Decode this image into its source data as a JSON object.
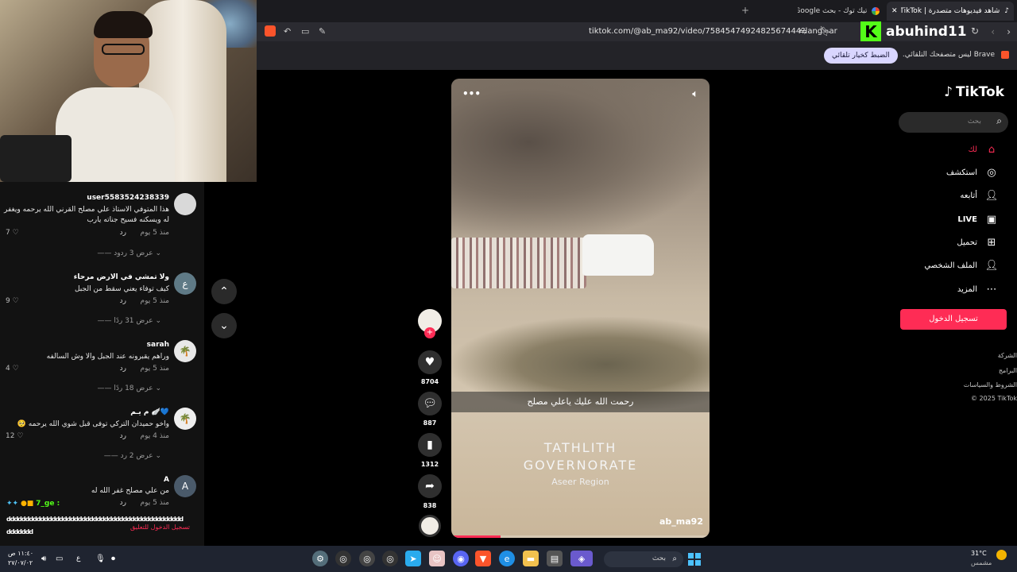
{
  "browser": {
    "tabs": [
      {
        "label": "شاهد فيديوهات متصدرة | TikTok",
        "active": true
      },
      {
        "label": "تيك توك - بحث Google",
        "active": false
      }
    ],
    "new_tab": "+",
    "url": "tiktok.com/@ab_ma92/video/7584547492482567444?lang=ar",
    "infobar_text": "Brave ليس متصفحك التلقائي.",
    "infobar_button": "الضبط كخيار تلقائي"
  },
  "stream_overlay": {
    "channel_name": "abuhind11",
    "channel_logo": "K"
  },
  "comments": [
    {
      "user": "user5583524238339",
      "text": "هذا المتوفي الاستاذ علي مصلح القرني الله يرحمه ويغفر له ويسكنه فسيح جناته يارب",
      "time": "منذ 5 يوم",
      "reply": "رد",
      "likes": "7",
      "replies_label": "عرض 3 ردود",
      "avatar": ""
    },
    {
      "user": "ولا تمشي في الارض مرحاء",
      "text": "كيف توفاء يعني سقط من الجبل",
      "time": "منذ 5 يوم",
      "reply": "رد",
      "likes": "9",
      "replies_label": "عرض 31 ردًا",
      "avatar": "ع"
    },
    {
      "user": "sarah",
      "text": "وراهم يقبرونه عند الجبل والا وش السالفه",
      "time": "منذ 5 يوم",
      "reply": "رد",
      "likes": "4",
      "replies_label": "عرض 18 ردًا",
      "avatar": "🌴"
    },
    {
      "user": "م يـم 🪽💙",
      "text": "واخو حميدان التركي توفى قبل شوي الله يرحمه 🥺",
      "time": "منذ 4 يوم",
      "reply": "رد",
      "likes": "12",
      "replies_label": "عرض 2 رد",
      "avatar": "🌴"
    },
    {
      "user": "A",
      "text": "من علي مصلح غفر الله له",
      "time": "منذ 5 يوم",
      "reply": "رد",
      "likes": "",
      "replies_label": "",
      "avatar": "A"
    }
  ],
  "chat": {
    "user": "7_ge :",
    "message": "ddddddddddddddddddddddddddddddddddddddddddddddd",
    "message2": "ddddddd",
    "login_prompt": "تسجيل الدخول للتعليق"
  },
  "video": {
    "caption": "رحمت الله عليك ياعلي مصلح",
    "location_line1": "TATHLITH",
    "location_line2": "GOVERNORATE",
    "location_region": "Aseer Region",
    "handle": "ab_ma92",
    "more": "•••",
    "progress": 0.19
  },
  "actions": {
    "likes": "8704",
    "comments": "887",
    "saves": "1312",
    "shares": "838",
    "follow": "+"
  },
  "tiktok_sidebar": {
    "logo": "TikTok",
    "search_placeholder": "بحث",
    "items": [
      {
        "label": "لك",
        "icon": "home-icon"
      },
      {
        "label": "استكشف",
        "icon": "compass-icon"
      },
      {
        "label": "أتابعه",
        "icon": "following-icon"
      },
      {
        "label": "LIVE",
        "icon": "live-icon"
      },
      {
        "label": "تحميل",
        "icon": "upload-icon"
      },
      {
        "label": "الملف الشخصي",
        "icon": "profile-icon"
      },
      {
        "label": "المزيد",
        "icon": "more-icon"
      }
    ],
    "login_button": "تسجيل الدخول",
    "footer": [
      "الشركة",
      "البرامج",
      "الشروط والسياسات",
      "© 2025 TikTok"
    ]
  },
  "taskbar": {
    "weather_temp": "31°C",
    "weather_desc": "مشمس",
    "search_label": "بحث",
    "time": "١١:٤٠ ص",
    "date": "٢٧/٠٧/٠٢",
    "lang": "ع"
  },
  "colors": {
    "accent": "#fe2c55",
    "kick_green": "#53fc18",
    "pill": "#d9d6ff"
  }
}
